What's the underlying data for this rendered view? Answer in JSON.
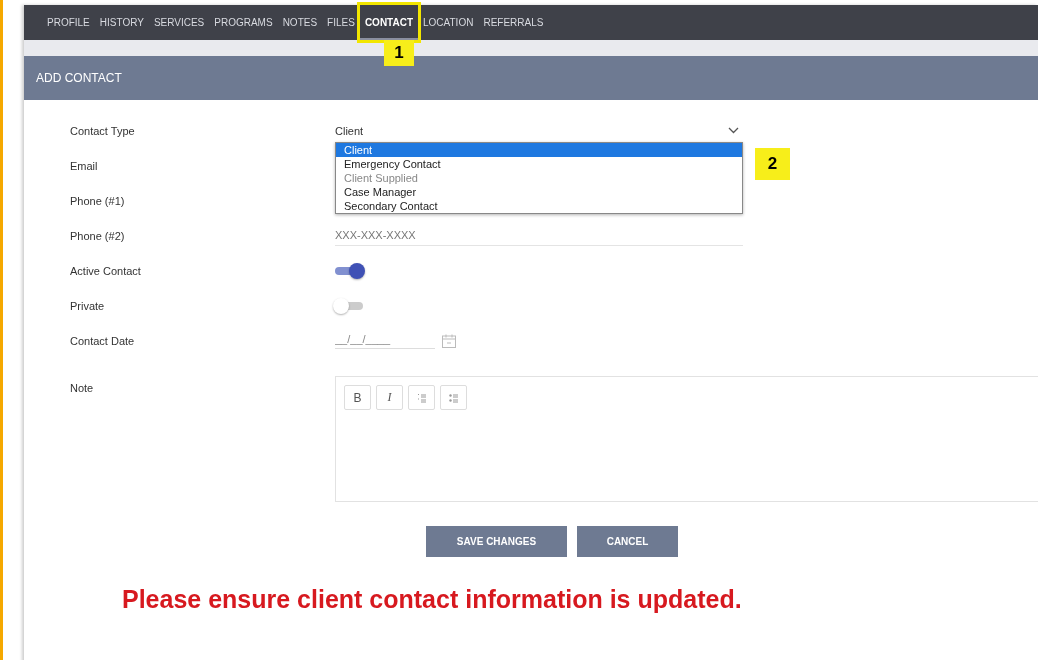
{
  "tabs": [
    {
      "label": "PROFILE",
      "selected": false,
      "highlighted": false
    },
    {
      "label": "HISTORY",
      "selected": false,
      "highlighted": false
    },
    {
      "label": "SERVICES",
      "selected": false,
      "highlighted": false
    },
    {
      "label": "PROGRAMS",
      "selected": false,
      "highlighted": false
    },
    {
      "label": "NOTES",
      "selected": false,
      "highlighted": false
    },
    {
      "label": "FILES",
      "selected": false,
      "highlighted": false
    },
    {
      "label": "CONTACT",
      "selected": true,
      "highlighted": true
    },
    {
      "label": "LOCATION",
      "selected": false,
      "highlighted": false
    },
    {
      "label": "REFERRALS",
      "selected": false,
      "highlighted": false
    }
  ],
  "tab_callout": "1",
  "panel_title": "ADD CONTACT",
  "fields": [
    {
      "kind": "select",
      "label": "Contact Type",
      "value": "Client",
      "expanded": true,
      "options": [
        {
          "label": "Client",
          "selected": true,
          "disabled": false
        },
        {
          "label": "Emergency Contact",
          "selected": false,
          "disabled": false
        },
        {
          "label": "Client Supplied",
          "selected": false,
          "disabled": true
        },
        {
          "label": "Case Manager",
          "selected": false,
          "disabled": false
        },
        {
          "label": "Secondary Contact",
          "selected": false,
          "disabled": false
        }
      ],
      "callout": "2"
    },
    {
      "kind": "text",
      "label": "Email"
    },
    {
      "kind": "text",
      "label": "Phone (#1)"
    },
    {
      "kind": "text",
      "label": "Phone (#2)",
      "placeholder": "XXX-XXX-XXXX"
    },
    {
      "kind": "toggle",
      "label": "Active Contact",
      "on": true
    },
    {
      "kind": "toggle",
      "label": "Private",
      "on": false
    },
    {
      "kind": "date",
      "label": "Contact Date",
      "placeholder": "__/__/____"
    },
    {
      "kind": "editor",
      "label": "Note",
      "toolbar": [
        {
          "kind": "bold",
          "label": "B"
        },
        {
          "kind": "italic",
          "label": "I"
        },
        {
          "kind": "ordered-list"
        },
        {
          "kind": "bullet-list"
        }
      ]
    }
  ],
  "buttons": [
    {
      "label": "SAVE CHANGES"
    },
    {
      "label": "CANCEL"
    }
  ],
  "notice": "Please ensure client contact information is updated."
}
